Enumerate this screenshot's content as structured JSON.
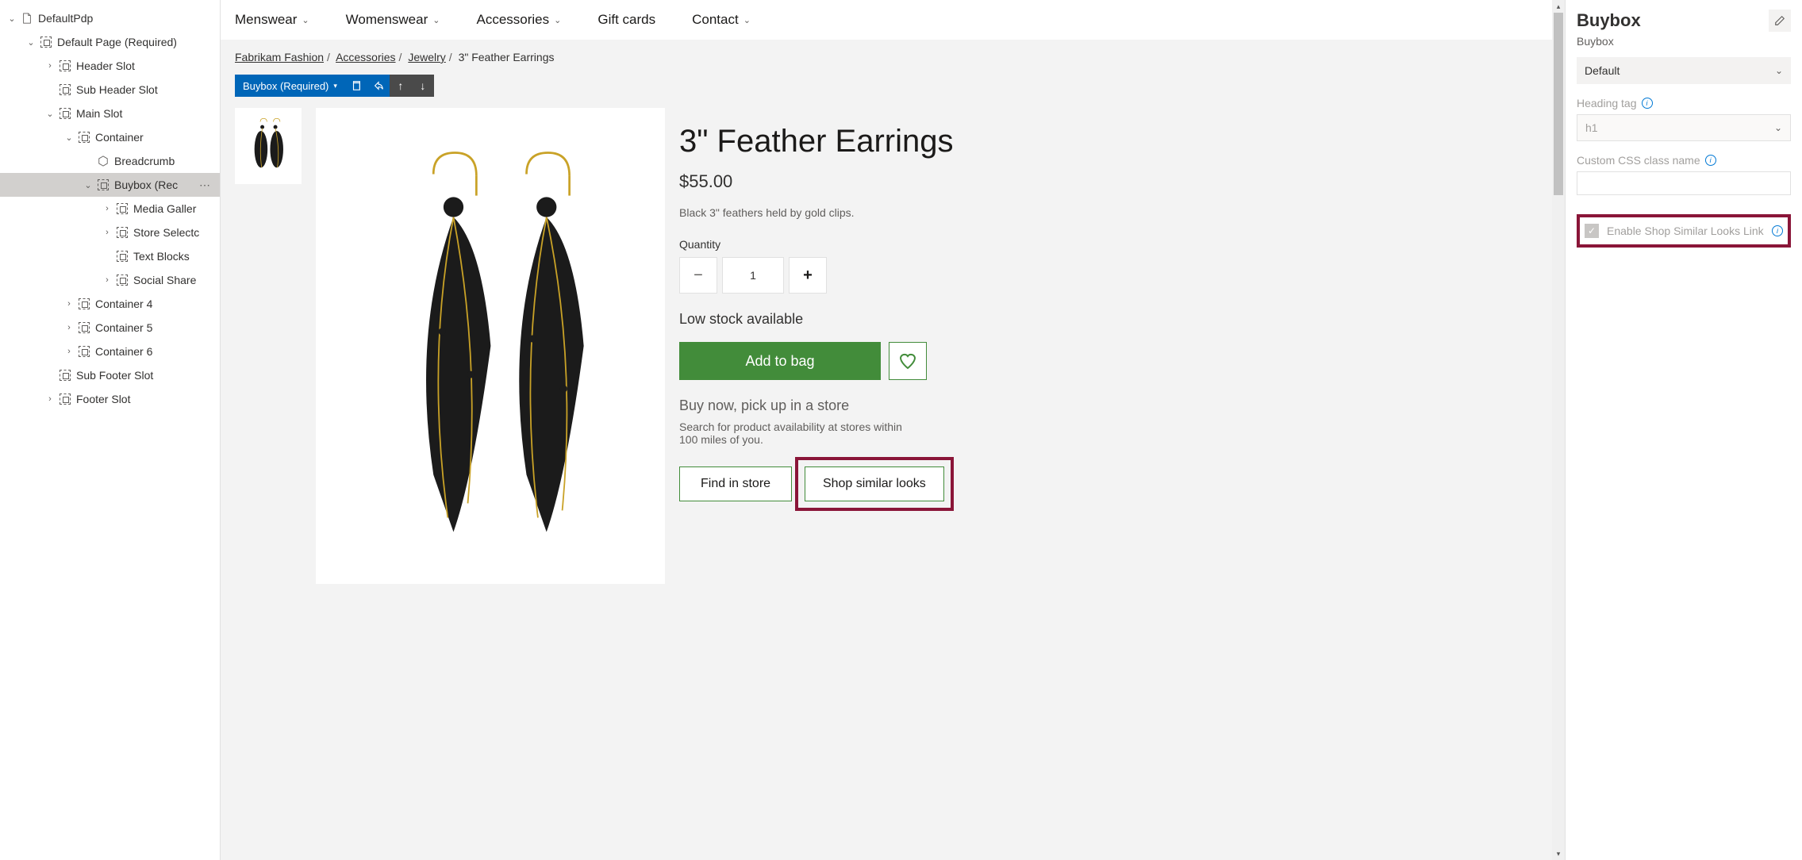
{
  "tree": {
    "root": "DefaultPdp",
    "items": [
      {
        "indent": 0,
        "chev": "down",
        "icon": "page",
        "label": "DefaultPdp"
      },
      {
        "indent": 1,
        "chev": "down",
        "icon": "slot",
        "label": "Default Page (Required)"
      },
      {
        "indent": 2,
        "chev": "right",
        "icon": "slot",
        "label": "Header Slot"
      },
      {
        "indent": 2,
        "chev": "",
        "icon": "slot",
        "label": "Sub Header Slot"
      },
      {
        "indent": 2,
        "chev": "down",
        "icon": "slot",
        "label": "Main Slot"
      },
      {
        "indent": 3,
        "chev": "down",
        "icon": "slot",
        "label": "Container"
      },
      {
        "indent": 4,
        "chev": "",
        "icon": "hex",
        "label": "Breadcrumb"
      },
      {
        "indent": 4,
        "chev": "down",
        "icon": "slot",
        "label": "Buybox (Rec",
        "selected": true,
        "more": true
      },
      {
        "indent": 5,
        "chev": "right",
        "icon": "slot",
        "label": "Media Galler"
      },
      {
        "indent": 5,
        "chev": "right",
        "icon": "slot",
        "label": "Store Selectc"
      },
      {
        "indent": 5,
        "chev": "",
        "icon": "slot",
        "label": "Text Blocks"
      },
      {
        "indent": 5,
        "chev": "right",
        "icon": "slot",
        "label": "Social Share"
      },
      {
        "indent": 3,
        "chev": "right",
        "icon": "slot",
        "label": "Container 4"
      },
      {
        "indent": 3,
        "chev": "right",
        "icon": "slot",
        "label": "Container 5"
      },
      {
        "indent": 3,
        "chev": "right",
        "icon": "slot",
        "label": "Container 6"
      },
      {
        "indent": 2,
        "chev": "",
        "icon": "slot",
        "label": "Sub Footer Slot"
      },
      {
        "indent": 2,
        "chev": "right",
        "icon": "slot",
        "label": "Footer Slot"
      }
    ]
  },
  "nav": {
    "items": [
      {
        "label": "Menswear",
        "chev": true
      },
      {
        "label": "Womenswear",
        "chev": true
      },
      {
        "label": "Accessories",
        "chev": true
      },
      {
        "label": "Gift cards",
        "chev": false
      },
      {
        "label": "Contact",
        "chev": true
      }
    ]
  },
  "breadcrumb": {
    "items": [
      "Fabrikam Fashion",
      "Accessories",
      "Jewelry"
    ],
    "current": "3\" Feather Earrings"
  },
  "toolbar": {
    "module_name": "Buybox (Required)"
  },
  "product": {
    "title": "3\" Feather Earrings",
    "price": "$55.00",
    "description": "Black 3\" feathers held by gold clips.",
    "qty_label": "Quantity",
    "qty_value": "1",
    "stock_msg": "Low stock available",
    "add_to_bag": "Add to bag",
    "pickup_title": "Buy now, pick up in a store",
    "pickup_desc": "Search for product availability at stores within 100 miles of you.",
    "find_in_store": "Find in store",
    "shop_similar": "Shop similar looks"
  },
  "props": {
    "title": "Buybox",
    "subtitle": "Buybox",
    "layout_value": "Default",
    "heading_tag_label": "Heading tag",
    "heading_tag_value": "h1",
    "css_label": "Custom CSS class name",
    "checkbox_label": "Enable Shop Similar Looks Link"
  }
}
